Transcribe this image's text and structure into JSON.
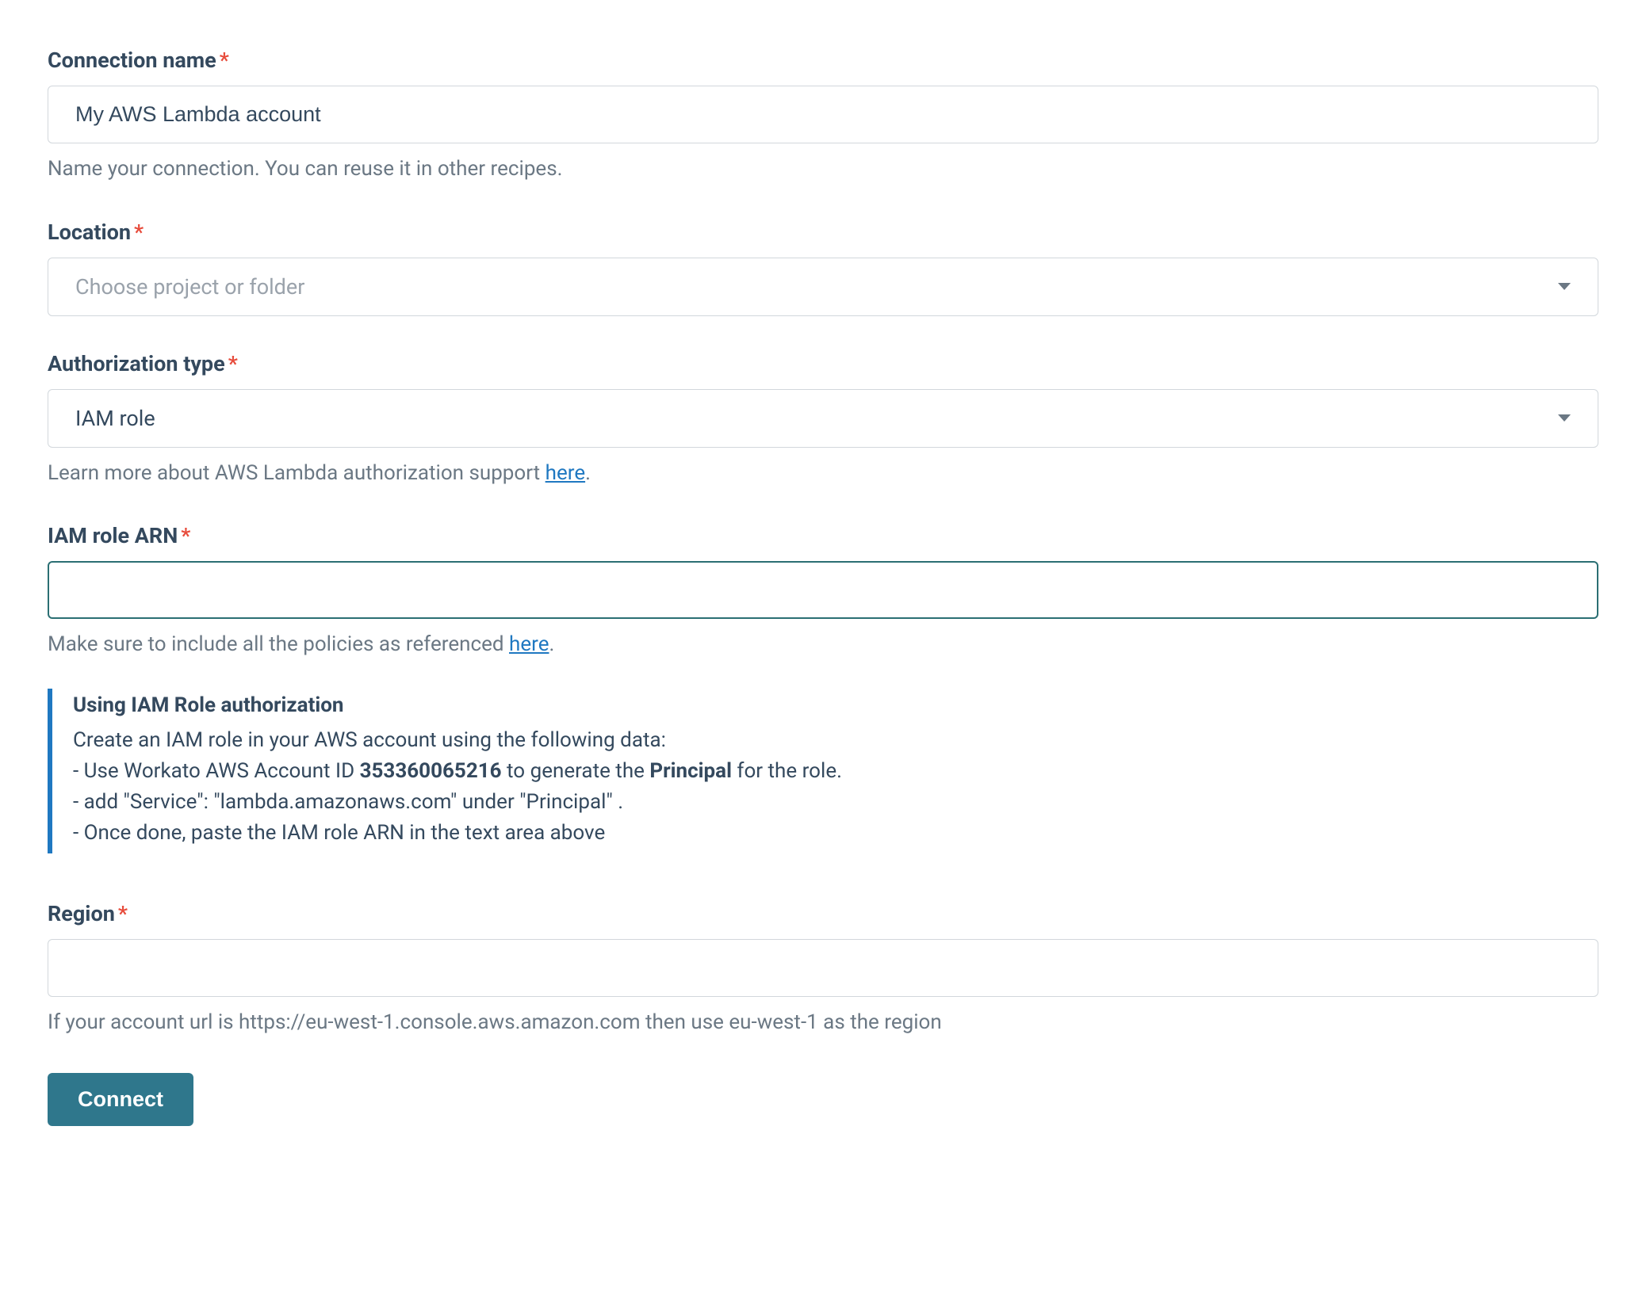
{
  "connection_name": {
    "label": "Connection name",
    "value": "My AWS Lambda account",
    "help": "Name your connection. You can reuse it in other recipes."
  },
  "location": {
    "label": "Location",
    "placeholder": "Choose project or folder"
  },
  "auth_type": {
    "label": "Authorization type",
    "value": "IAM role",
    "help_prefix": "Learn more about AWS Lambda authorization support ",
    "help_link_text": "here",
    "help_suffix": "."
  },
  "iam_role_arn": {
    "label": "IAM role ARN",
    "value": "",
    "help_prefix": "Make sure to include all the policies as referenced ",
    "help_link_text": "here",
    "help_suffix": "."
  },
  "iam_info": {
    "title": "Using IAM Role authorization",
    "intro": "Create an IAM role in your AWS account using the following data:",
    "line1_a": " - Use Workato AWS Account ID ",
    "line1_bold1": "353360065216",
    "line1_b": " to generate the ",
    "line1_bold2": "Principal",
    "line1_c": " for the role.",
    "line2": " - add \"Service\": \"lambda.amazonaws.com\" under \"Principal\" .",
    "line3": " - Once done, paste the IAM role ARN in the text area above"
  },
  "region": {
    "label": "Region",
    "value": "",
    "help": "If your account url is https://eu-west-1.console.aws.amazon.com then use eu-west-1 as the region"
  },
  "connect_button": "Connect",
  "required_marker": "*"
}
